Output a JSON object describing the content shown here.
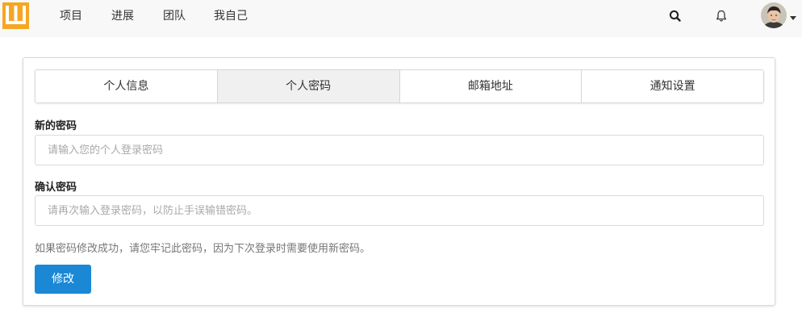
{
  "nav": {
    "items": [
      "项目",
      "进展",
      "团队",
      "我自己"
    ],
    "icons": [
      "search-icon",
      "bell-icon"
    ]
  },
  "tabs": [
    {
      "label": "个人信息",
      "active": false
    },
    {
      "label": "个人密码",
      "active": true
    },
    {
      "label": "邮箱地址",
      "active": false
    },
    {
      "label": "通知设置",
      "active": false
    }
  ],
  "form": {
    "new_password_label": "新的密码",
    "new_password_placeholder": "请输入您的个人登录密码",
    "new_password_value": "",
    "confirm_password_label": "确认密码",
    "confirm_password_placeholder": "请再次输入登录密码，以防止手误输错密码。",
    "confirm_password_value": "",
    "hint": "如果密码修改成功，请您牢记此密码，因为下次登录时需要使用新密码。",
    "submit_label": "修改"
  },
  "colors": {
    "logo": "#f5a623",
    "primary_button": "#1b88d6",
    "topbar_bg": "#f8f8f8",
    "active_tab_bg": "#f0f0f0"
  }
}
